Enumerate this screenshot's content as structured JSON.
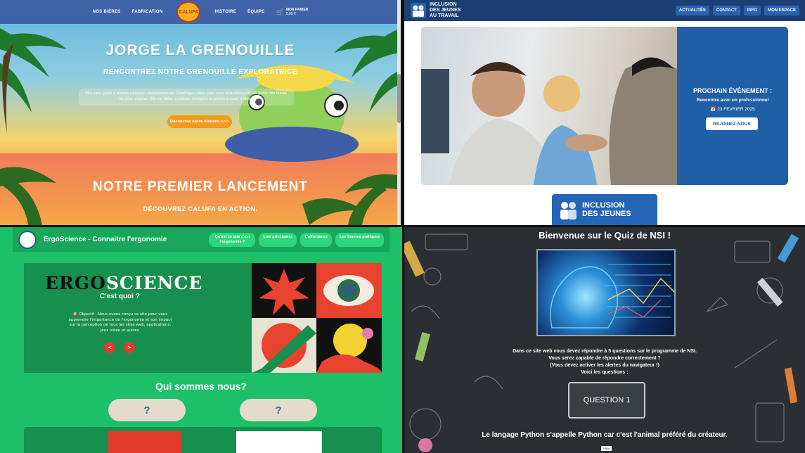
{
  "calufa": {
    "nav": [
      "NOS BIÈRES",
      "FABRICATION",
      "HISTOIRE",
      "ÉQUIPE"
    ],
    "logo": "CALUFA",
    "cart_label": "MON PANIER",
    "cart_amount": "0,00 €",
    "hero_title": "JORGE LA GRENOUILLE",
    "hero_subtitle": "RENCONTREZ NOTRE GRENOUILLE EXPLORATRICE",
    "hero_text": "Elle vous guide à travers plusieurs destinations de l'Amérique latine pour vous faire découvrir les goûts des bières les plus uniques. Elle est drôle, curieuse, intrépide et jamais à court d'idées.",
    "hero_cta": "Découvrez notre histoire >>>",
    "launch_title": "NOTRE PREMIER LANCEMENT",
    "launch_subtitle": "DÉCOUVREZ CALUFA EN ACTION."
  },
  "inclusion": {
    "brand": [
      "INCLUSION",
      "DES JEUNES",
      "AU TRAVAIL"
    ],
    "menu": [
      "ACTUALITÉS",
      "CONTACT",
      "INFO",
      "MON ESPACE"
    ],
    "event_title": "PROCHAIN ÉVÈNEMENT :",
    "event_subtitle": "Rencontre avec un professionnel",
    "event_date": "23 FEVRIER 2025",
    "event_cta": "REJOINEZ-NOUS",
    "footer_logo": [
      "INCLUSION",
      "DES JEUNES"
    ]
  },
  "ergo": {
    "title": "ErgoScience - Connaitre l'ergonomie",
    "nav": [
      "Qu'est ce que c'est l'ergonomie ?",
      "Lois principales",
      "L'affordance",
      "Les bonnes pratiques"
    ],
    "logo_a": "ERGO",
    "logo_b": "SCIENCE",
    "question": "C'est quoi ?",
    "objective": "🎯 Objectif : Nous avons conçu ce site pour vous apprendre l'importance de l'ergonomie et son impact sur la perception de tous les sites web, applications, jeux vidéo et autres.",
    "prev": "<",
    "next": ">",
    "who": "Qui sommes nous?",
    "pill_1": "?",
    "pill_2": "?"
  },
  "quiz": {
    "title": "Bienvenue sur le Quiz de NSI !",
    "intro": [
      "Dans ce site web vous devez répondre à 5 questions sur le programme de NSI.",
      "Vous serez capable de répondre correctement ?",
      "(Vous devez activer les alertes du navigateur !)",
      "Voici les questions :"
    ],
    "button": "QUESTION 1",
    "statement": "Le langage Python s'appelle Python car c'est l'animal préféré du créateur.",
    "answer": "VRAI"
  }
}
